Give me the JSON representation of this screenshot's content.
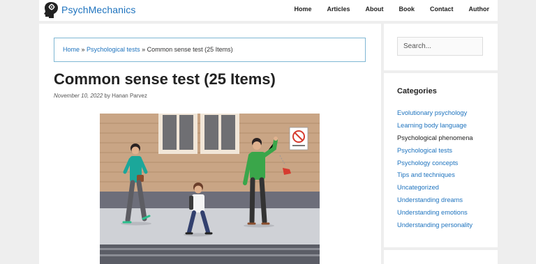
{
  "site": {
    "name": "PsychMechanics"
  },
  "nav": [
    "Home",
    "Articles",
    "About",
    "Book",
    "Contact",
    "Author"
  ],
  "breadcrumb": {
    "home": "Home",
    "sep1": " » ",
    "section": "Psychological tests",
    "sep2": " » ",
    "current": "Common sense test (25 Items)"
  },
  "article": {
    "title": "Common sense test (25 Items)",
    "date": "November 10, 2022",
    "by": " by ",
    "author": "Hanan Parvez"
  },
  "sidebar": {
    "search_placeholder": "Search...",
    "categories_title": "Categories",
    "categories": [
      "Evolutionary psychology",
      "Learning body language",
      "Psychological phenomena",
      "Psychological tests",
      "Psychology concepts",
      "Tips and techniques",
      "Uncategorized",
      "Understanding dreams",
      "Understanding emotions",
      "Understanding personality"
    ]
  },
  "colors": {
    "link": "#1e73be",
    "breadcrumb_border": "#7fb7d4",
    "page_bg": "#eeeeee"
  }
}
